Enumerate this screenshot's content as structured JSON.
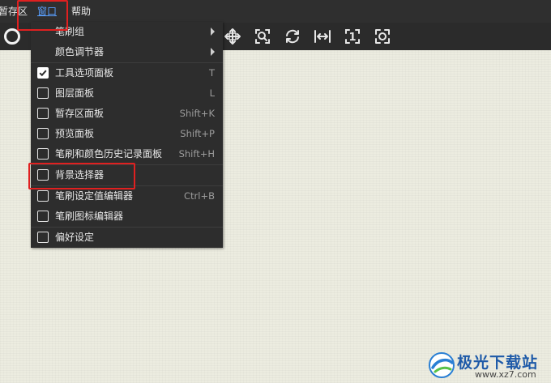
{
  "menubar": {
    "items": [
      {
        "label": "暂存区"
      },
      {
        "label": "窗口"
      },
      {
        "label": "帮助"
      }
    ]
  },
  "toolbar": {
    "icons": [
      "brush-size-icon",
      "move-icon",
      "zoom-icon",
      "rotate-icon",
      "fit-width-icon",
      "actual-size-icon",
      "fullscreen-icon"
    ],
    "actual_size_glyph": "1"
  },
  "window_menu": {
    "items": [
      {
        "label": "笔刷组",
        "submenu": true
      },
      {
        "label": "颜色调节器",
        "submenu": true
      },
      {
        "label": "工具选项面板",
        "shortcut": "T",
        "checked": true
      },
      {
        "label": "图层面板",
        "shortcut": "L",
        "checked": false
      },
      {
        "label": "暂存区面板",
        "shortcut": "Shift+K",
        "checked": false
      },
      {
        "label": "预览面板",
        "shortcut": "Shift+P",
        "checked": false
      },
      {
        "label": "笔刷和颜色历史记录面板",
        "shortcut": "Shift+H",
        "checked": false
      },
      {
        "label": "背景选择器",
        "shortcut": "",
        "checked": false
      },
      {
        "label": "笔刷设定值编辑器",
        "shortcut": "Ctrl+B",
        "checked": false
      },
      {
        "label": "笔刷图标编辑器",
        "shortcut": "",
        "checked": false
      },
      {
        "label": "偏好设定",
        "shortcut": "",
        "checked": false
      }
    ]
  },
  "watermark": {
    "name": "极光下载站",
    "url": "www.xz7.com"
  },
  "colors": {
    "menubar_bg": "#2f2f2f",
    "menu_bg": "#2d2d2d",
    "canvas_bg": "#ecece0",
    "highlight": "#e02020",
    "active_menu": "#5aa0ff",
    "watermark_blue": "#1e5aa8"
  }
}
